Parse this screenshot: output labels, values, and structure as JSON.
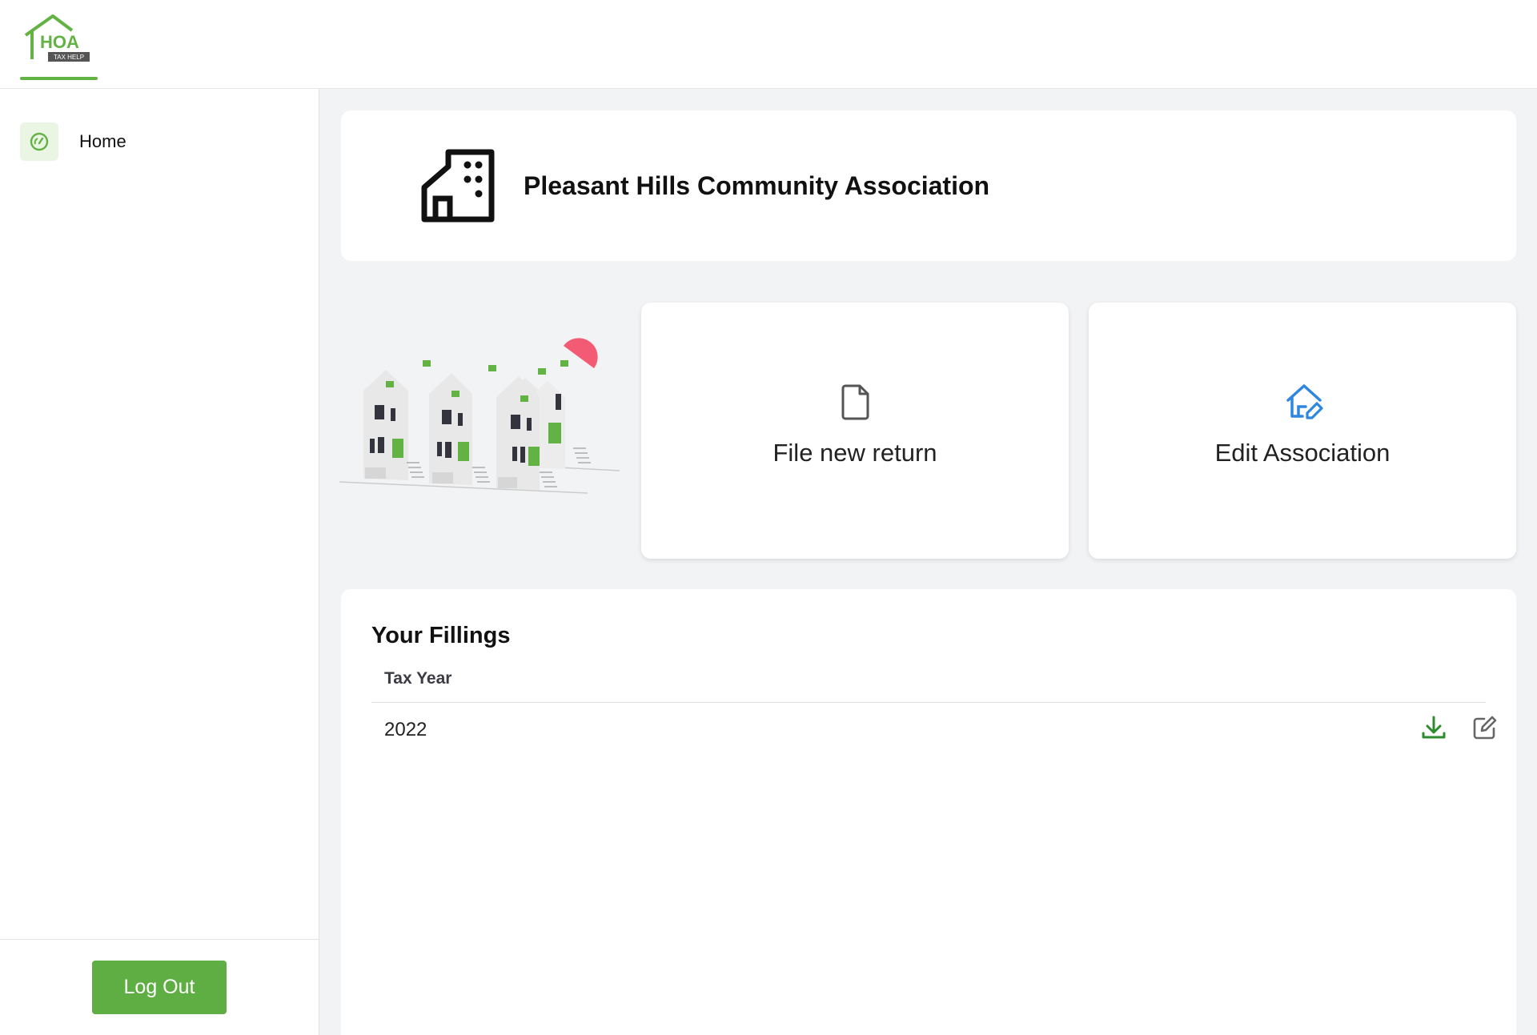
{
  "app": {
    "logo_text": "HOA",
    "logo_subtext": "TAX HELP",
    "brand_color": "#63b244"
  },
  "sidebar": {
    "items": [
      {
        "label": "Home",
        "icon": "dashboard-gauge-icon",
        "active": true
      }
    ],
    "logout_label": "Log Out"
  },
  "association": {
    "name": "Pleasant Hills Community Association",
    "icon": "building-icon"
  },
  "actions": {
    "file_new_return": {
      "label": "File new return",
      "icon": "file-icon"
    },
    "edit_association": {
      "label": "Edit Association",
      "icon": "house-edit-icon",
      "icon_color": "#2f86e0"
    }
  },
  "filings": {
    "title": "Your Fillings",
    "columns": [
      "Tax Year"
    ],
    "rows": [
      {
        "tax_year": "2022",
        "actions": [
          "download-icon",
          "edit-icon"
        ]
      }
    ],
    "download_color": "#2e8b2e",
    "edit_color": "#666666"
  }
}
